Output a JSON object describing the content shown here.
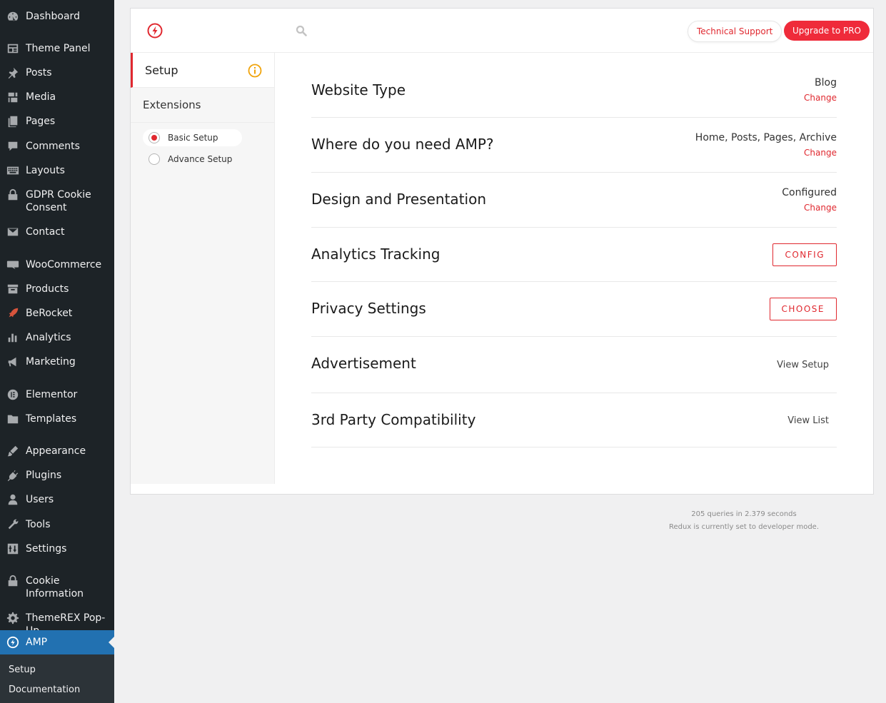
{
  "sidebar": {
    "items": [
      {
        "label": "Dashboard",
        "icon": "dashboard-icon"
      },
      {
        "label": "Theme Panel",
        "icon": "theme-panel-icon"
      },
      {
        "label": "Posts",
        "icon": "pin-icon"
      },
      {
        "label": "Media",
        "icon": "media-icon"
      },
      {
        "label": "Pages",
        "icon": "pages-icon"
      },
      {
        "label": "Comments",
        "icon": "comments-icon"
      },
      {
        "label": "Layouts",
        "icon": "keyboard-icon"
      },
      {
        "label": "GDPR Cookie Consent",
        "icon": "lock-icon"
      },
      {
        "label": "Contact",
        "icon": "mail-icon"
      },
      {
        "label": "WooCommerce",
        "icon": "woo-icon"
      },
      {
        "label": "Products",
        "icon": "archive-icon"
      },
      {
        "label": "BeRocket",
        "icon": "rocket-icon"
      },
      {
        "label": "Analytics",
        "icon": "bar-chart-icon"
      },
      {
        "label": "Marketing",
        "icon": "megaphone-icon"
      },
      {
        "label": "Elementor",
        "icon": "elementor-icon"
      },
      {
        "label": "Templates",
        "icon": "folder-icon"
      },
      {
        "label": "Appearance",
        "icon": "brush-icon"
      },
      {
        "label": "Plugins",
        "icon": "plug-icon"
      },
      {
        "label": "Users",
        "icon": "user-icon"
      },
      {
        "label": "Tools",
        "icon": "wrench-icon"
      },
      {
        "label": "Settings",
        "icon": "settings-icon"
      },
      {
        "label": "Cookie Information",
        "icon": "lock-icon"
      },
      {
        "label": "ThemeREX Pop-Up",
        "icon": "gear-icon"
      },
      {
        "label": "AMP",
        "icon": "amp-bolt-icon"
      }
    ],
    "submenu": [
      "Setup",
      "Documentation"
    ]
  },
  "topbar": {
    "support_label": "Technical Support",
    "pro_label": "Upgrade to PRO"
  },
  "nav": {
    "setup_label": "Setup",
    "extensions_label": "Extensions",
    "options": [
      "Basic Setup",
      "Advance Setup"
    ]
  },
  "rows": {
    "website_type": {
      "title": "Website Type",
      "value": "Blog",
      "action": "Change"
    },
    "where_amp": {
      "title": "Where do you need AMP?",
      "value": "Home, Posts, Pages, Archive",
      "action": "Change"
    },
    "design": {
      "title": "Design and Presentation",
      "value": "Configured",
      "action": "Change"
    },
    "analytics": {
      "title": "Analytics Tracking",
      "action": "CONFIG"
    },
    "privacy": {
      "title": "Privacy Settings",
      "action": "CHOOSE"
    },
    "advertisement": {
      "title": "Advertisement",
      "action": "View Setup"
    },
    "third_party": {
      "title": "3rd Party Compatibility",
      "action": "View List"
    }
  },
  "footer": {
    "queries": "205 queries in 2.379 seconds",
    "redux": "Redux is currently set to developer mode."
  },
  "colors": {
    "accent": "#e0282f",
    "admin_bg": "#1d2327",
    "admin_current": "#2271b1",
    "info": "#f0a30a"
  }
}
